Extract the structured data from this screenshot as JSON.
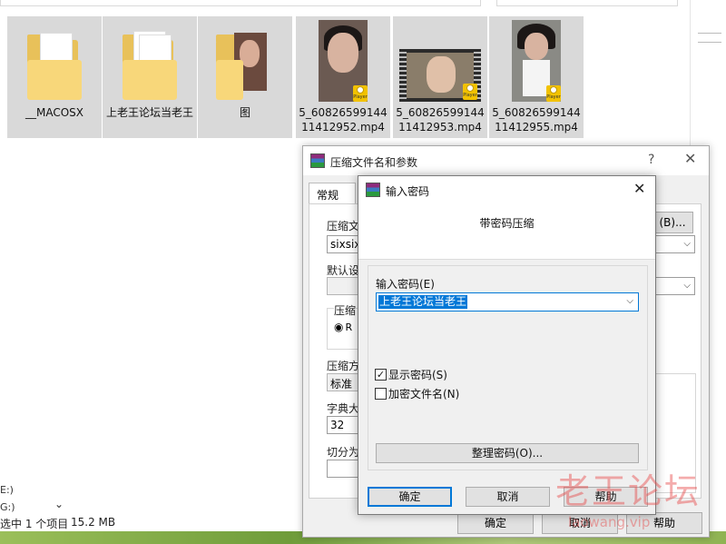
{
  "explorer": {
    "files": [
      {
        "name": "__MACOSX",
        "type": "folder"
      },
      {
        "name": "上老王论坛当老王",
        "type": "folder"
      },
      {
        "name": "图",
        "type": "folder"
      },
      {
        "name": "5_6082659914411412952.mp4",
        "type": "video"
      },
      {
        "name": "5_6082659914411412953.mp4",
        "type": "video"
      },
      {
        "name": "5_6082659914411412955.mp4",
        "type": "video"
      }
    ],
    "badge_text": "Player",
    "status": {
      "selection": "选中 1 个项目",
      "size": "15.2 MB"
    },
    "drive_fragment": "G:)",
    "left_fragment": "E:)"
  },
  "archive_dialog": {
    "title": "压缩文件名和参数",
    "help": "?",
    "close": "✕",
    "tab_general": "常规",
    "archive_name_label": "压缩文",
    "archive_name_value": "sixsixs",
    "browse_button": "(B)...",
    "default_profile_label": "默认设",
    "format_group_label": "压缩",
    "radio_partial": "R",
    "method_label": "压缩方",
    "method_value": "标准",
    "dict_label": "字典大",
    "dict_value": "32",
    "split_label": "切分为",
    "ok_button": "确定",
    "cancel_button": "取消",
    "help_button": "帮助"
  },
  "password_dialog": {
    "title": "输入密码",
    "subtitle": "带密码压缩",
    "input_label": "输入密码(E)",
    "password_value": "上老王论坛当老王",
    "show_password": {
      "label": "显示密码(S)",
      "checked": true
    },
    "encrypt_names": {
      "label": "加密文件名(N)",
      "checked": false
    },
    "organize_button": "整理密码(O)...",
    "ok_button": "确定",
    "cancel_button": "取消",
    "help_button": "帮助"
  },
  "watermark": {
    "big": "老王论坛",
    "small": "laowang.vip"
  }
}
